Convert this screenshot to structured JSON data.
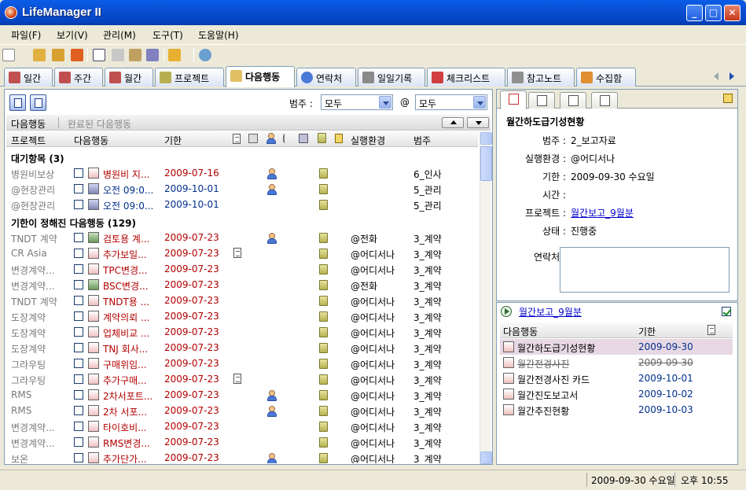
{
  "window": {
    "title": "LifeManager II",
    "min": "_",
    "max": "□",
    "close": "✕"
  },
  "menu": [
    "파일(F)",
    "보기(V)",
    "관리(M)",
    "도구(T)",
    "도움말(H)"
  ],
  "tabs": [
    {
      "label": "일간",
      "color": "#c05050"
    },
    {
      "label": "주간",
      "color": "#c05050"
    },
    {
      "label": "월간",
      "color": "#c05050"
    },
    {
      "label": "프로젝트",
      "color": "#b8b050"
    },
    {
      "label": "다음행동",
      "color": "#e0c060"
    },
    {
      "label": "연락처",
      "color": "#4a7ad8"
    },
    {
      "label": "일일기록",
      "color": "#8a8a8a"
    },
    {
      "label": "체크리스트",
      "color": "#d04040"
    },
    {
      "label": "참고노트",
      "color": "#909090"
    },
    {
      "label": "수집함",
      "color": "#e09030"
    }
  ],
  "filter": {
    "category_label": "범주 :",
    "category_value": "모두",
    "context_label": "@",
    "context_value": "모두"
  },
  "subheader": {
    "active": "다음행동",
    "completed": "완료된 다음행동"
  },
  "columns": {
    "project": "프로젝트",
    "action": "다음행동",
    "due": "기한",
    "context": "실행환경",
    "category": "범주"
  },
  "groups": [
    {
      "title": "대기항목 (3)",
      "rows": [
        {
          "project": "병원비보상",
          "action": "병원비 지...",
          "due": "2009-07-16",
          "person": true,
          "doc": false,
          "context": "",
          "category": "6_인사",
          "color": "red",
          "icon": "note"
        },
        {
          "project": "@현장관리",
          "action": "오전 09:0...",
          "due": "2009-10-01",
          "person": true,
          "doc": false,
          "context": "",
          "category": "5_관리",
          "color": "blue",
          "icon": "phone"
        },
        {
          "project": "@현장관리",
          "action": "오전 09:0...",
          "due": "2009-10-01",
          "person": false,
          "doc": false,
          "context": "",
          "category": "5_관리",
          "color": "blue",
          "icon": "phone"
        }
      ]
    },
    {
      "title": "기한이 정해진 다음행동 (129)",
      "rows": [
        {
          "project": "TNDT 계약",
          "action": "검토용 계...",
          "due": "2009-07-23",
          "person": true,
          "doc": false,
          "context": "@전화",
          "category": "3_계약",
          "color": "red",
          "icon": "calc"
        },
        {
          "project": "CR Asia",
          "action": "추가보일...",
          "due": "2009-07-23",
          "person": false,
          "doc": true,
          "context": "@어디서나",
          "category": "3_계약",
          "color": "red",
          "icon": "note"
        },
        {
          "project": "변경계약...",
          "action": "TPC변경...",
          "due": "2009-07-23",
          "person": false,
          "doc": false,
          "context": "@어디서나",
          "category": "3_계약",
          "color": "red",
          "icon": "note"
        },
        {
          "project": "변경계약...",
          "action": "BSC변경...",
          "due": "2009-07-23",
          "person": false,
          "doc": false,
          "context": "@전화",
          "category": "3_계약",
          "color": "red",
          "icon": "calc"
        },
        {
          "project": "TNDT 계약",
          "action": "TNDT용 ...",
          "due": "2009-07-23",
          "person": false,
          "doc": false,
          "context": "@어디서나",
          "category": "3_계약",
          "color": "red",
          "icon": "note"
        },
        {
          "project": "도장계약",
          "action": "계약의뢰 ...",
          "due": "2009-07-23",
          "person": false,
          "doc": false,
          "context": "@어디서나",
          "category": "3_계약",
          "color": "red",
          "icon": "note"
        },
        {
          "project": "도장계약",
          "action": "업체비교 ...",
          "due": "2009-07-23",
          "person": false,
          "doc": false,
          "context": "@어디서나",
          "category": "3_계약",
          "color": "red",
          "icon": "note"
        },
        {
          "project": "도장계약",
          "action": "TNJ 회사...",
          "due": "2009-07-23",
          "person": false,
          "doc": false,
          "context": "@어디서나",
          "category": "3_계약",
          "color": "red",
          "icon": "note"
        },
        {
          "project": "그라우팅",
          "action": "구매위임...",
          "due": "2009-07-23",
          "person": false,
          "doc": false,
          "context": "@어디서나",
          "category": "3_계약",
          "color": "red",
          "icon": "note"
        },
        {
          "project": "그라우팅",
          "action": "추가구매...",
          "due": "2009-07-23",
          "person": false,
          "doc": true,
          "context": "@어디서나",
          "category": "3_계약",
          "color": "red",
          "icon": "note"
        },
        {
          "project": "RMS",
          "action": "2차서포트...",
          "due": "2009-07-23",
          "person": true,
          "doc": false,
          "context": "@어디서나",
          "category": "3_계약",
          "color": "red",
          "icon": "note"
        },
        {
          "project": "RMS",
          "action": "2차 서포...",
          "due": "2009-07-23",
          "person": true,
          "doc": false,
          "context": "@어디서나",
          "category": "3_계약",
          "color": "red",
          "icon": "note"
        },
        {
          "project": "변경계약...",
          "action": "타이호비...",
          "due": "2009-07-23",
          "person": false,
          "doc": false,
          "context": "@어디서나",
          "category": "3_계약",
          "color": "red",
          "icon": "note"
        },
        {
          "project": "변경계약...",
          "action": "RMS변경...",
          "due": "2009-07-23",
          "person": false,
          "doc": false,
          "context": "@어디서나",
          "category": "3_계약",
          "color": "red",
          "icon": "note"
        },
        {
          "project": "보온",
          "action": "추가단가...",
          "due": "2009-07-23",
          "person": true,
          "doc": false,
          "context": "@어디서나",
          "category": "3_계약",
          "color": "red",
          "icon": "note"
        }
      ]
    }
  ],
  "detail": {
    "title": "월간하도급기성현황",
    "fields": [
      {
        "k": "범주 :",
        "v": "2_보고자료",
        "link": false
      },
      {
        "k": "실행환경 :",
        "v": "@어디서나",
        "link": false
      },
      {
        "k": "기한 :",
        "v": "2009-09-30 수요일",
        "link": false
      },
      {
        "k": "시간 :",
        "v": "",
        "link": false
      },
      {
        "k": "프로젝트 :",
        "v": "월간보고_9월분",
        "link": true
      },
      {
        "k": "상태 :",
        "v": "진행중",
        "link": false
      }
    ],
    "contact_label": "연락처 :"
  },
  "related": {
    "project": "월간보고_9월분",
    "col_action": "다음행동",
    "col_due": "기한",
    "rows": [
      {
        "action": "월간하도급기성현황",
        "due": "2009-09-30",
        "done": false,
        "selected": true
      },
      {
        "action": "월간전경사진",
        "due": "2009-09-30",
        "done": true,
        "selected": false
      },
      {
        "action": "월간전경사진 카드",
        "due": "2009-10-01",
        "done": false,
        "selected": false
      },
      {
        "action": "월간진도보고서",
        "due": "2009-10-02",
        "done": false,
        "selected": false
      },
      {
        "action": "월간추진현황",
        "due": "2009-10-03",
        "done": false,
        "selected": false
      }
    ]
  },
  "status": {
    "date": "2009-09-30 수요일",
    "time": "오후 10:55"
  }
}
